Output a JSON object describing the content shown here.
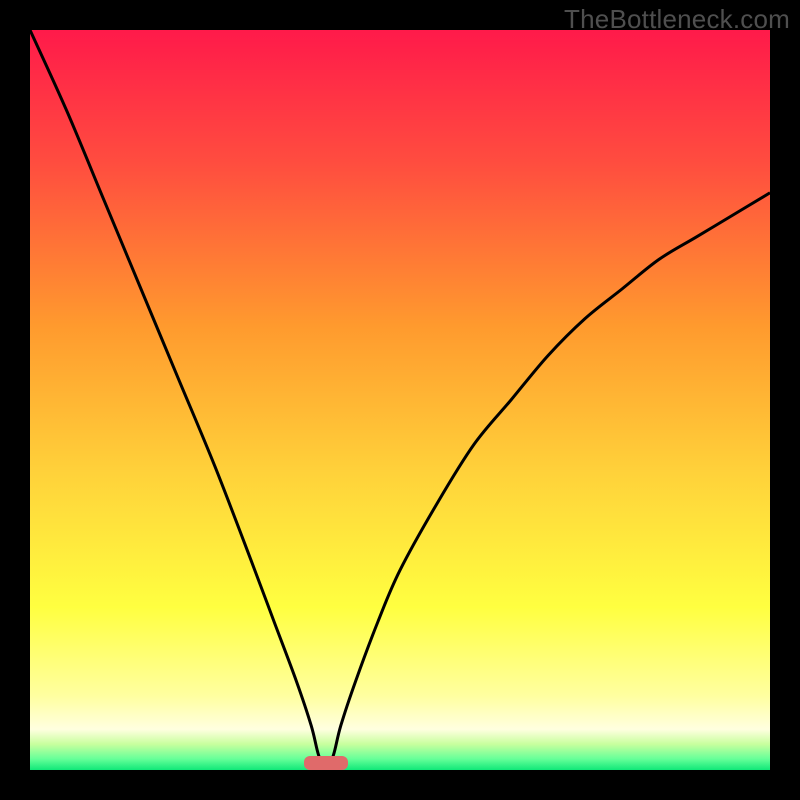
{
  "watermark": {
    "text": "TheBottleneck.com"
  },
  "chart_data": {
    "type": "line",
    "title": "",
    "xlabel": "",
    "ylabel": "",
    "xlim": [
      0,
      100
    ],
    "ylim": [
      0,
      100
    ],
    "grid": false,
    "legend": false,
    "background_gradient": {
      "orientation": "vertical",
      "stops": [
        {
          "pos": 0.0,
          "color": "#ff1a4a"
        },
        {
          "pos": 0.18,
          "color": "#ff4d3f"
        },
        {
          "pos": 0.4,
          "color": "#ff9a2e"
        },
        {
          "pos": 0.6,
          "color": "#ffd23a"
        },
        {
          "pos": 0.78,
          "color": "#ffff40"
        },
        {
          "pos": 0.9,
          "color": "#ffffa0"
        },
        {
          "pos": 0.945,
          "color": "#ffffe0"
        },
        {
          "pos": 0.965,
          "color": "#c8ff9e"
        },
        {
          "pos": 0.985,
          "color": "#66ff99"
        },
        {
          "pos": 1.0,
          "color": "#10e878"
        }
      ]
    },
    "minimum_marker": {
      "x": 40,
      "color": "#e06a6a"
    },
    "series": [
      {
        "name": "bottleneck-curve",
        "x": [
          0,
          5,
          10,
          15,
          20,
          25,
          30,
          33,
          36,
          38,
          39,
          40,
          41,
          42,
          44,
          47,
          50,
          55,
          60,
          65,
          70,
          75,
          80,
          85,
          90,
          95,
          100
        ],
        "y": [
          100,
          89,
          77,
          65,
          53,
          41,
          28,
          20,
          12,
          6,
          2,
          0,
          2,
          6,
          12,
          20,
          27,
          36,
          44,
          50,
          56,
          61,
          65,
          69,
          72,
          75,
          78
        ]
      }
    ]
  }
}
